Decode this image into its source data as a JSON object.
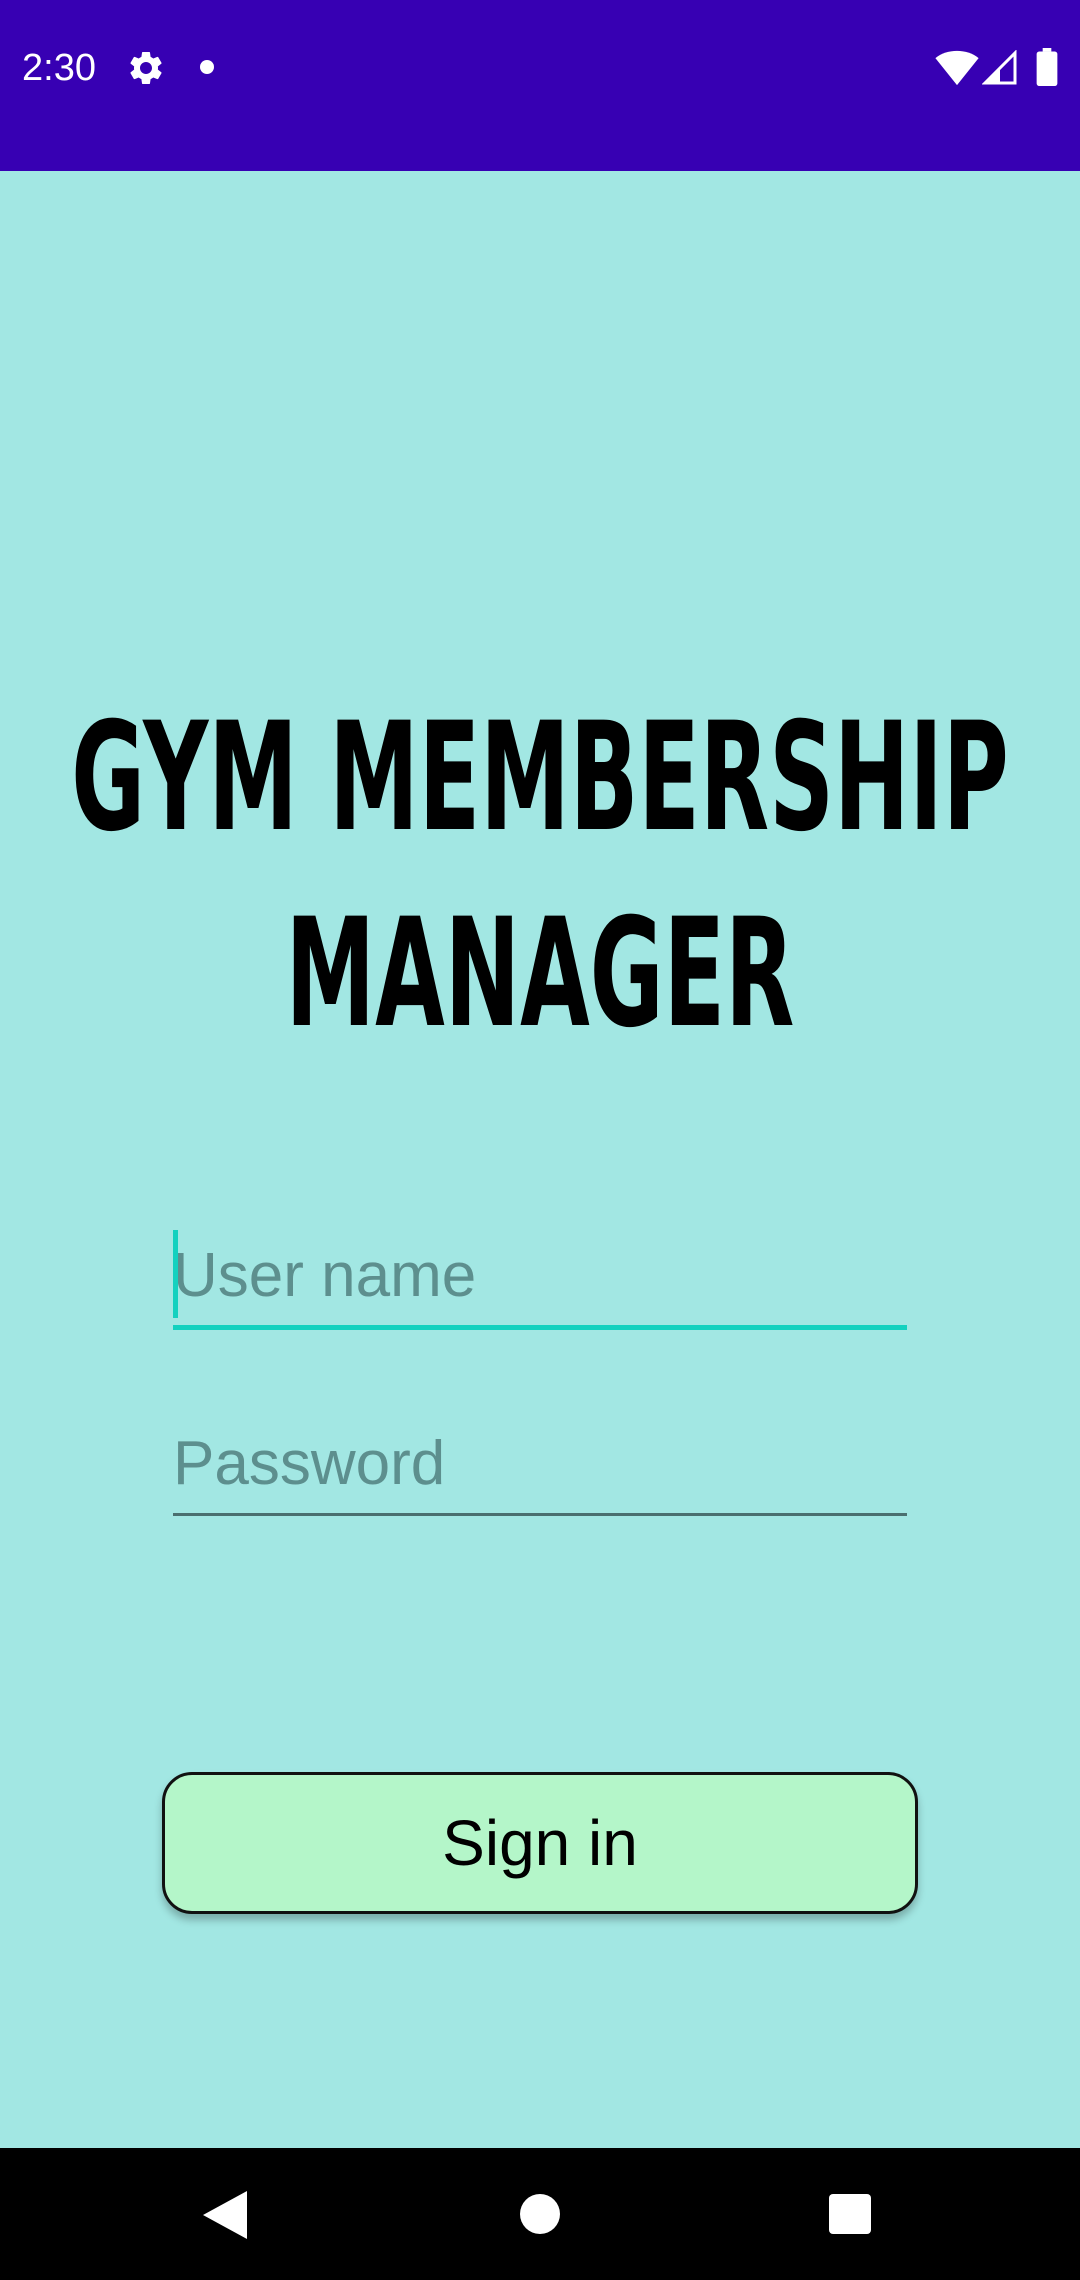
{
  "status_bar": {
    "time": "2:30",
    "icons": [
      "gear-icon",
      "notification-dot-icon",
      "wifi-icon",
      "signal-icon",
      "battery-icon"
    ],
    "background": "#3700b3"
  },
  "app": {
    "title_line1": "GYM MEMBERSHIP",
    "title_line2": "MANAGER",
    "background": "#a2e7e3"
  },
  "form": {
    "username": {
      "value": "",
      "placeholder": "User name",
      "focused": true
    },
    "password": {
      "value": "",
      "placeholder": "Password",
      "focused": false
    },
    "accent_color": "#14d1bf"
  },
  "signin_button": {
    "label": "Sign in",
    "background": "#b4f6c9"
  },
  "nav_bar": {
    "icons": [
      "back-icon",
      "home-icon",
      "recents-icon"
    ]
  }
}
